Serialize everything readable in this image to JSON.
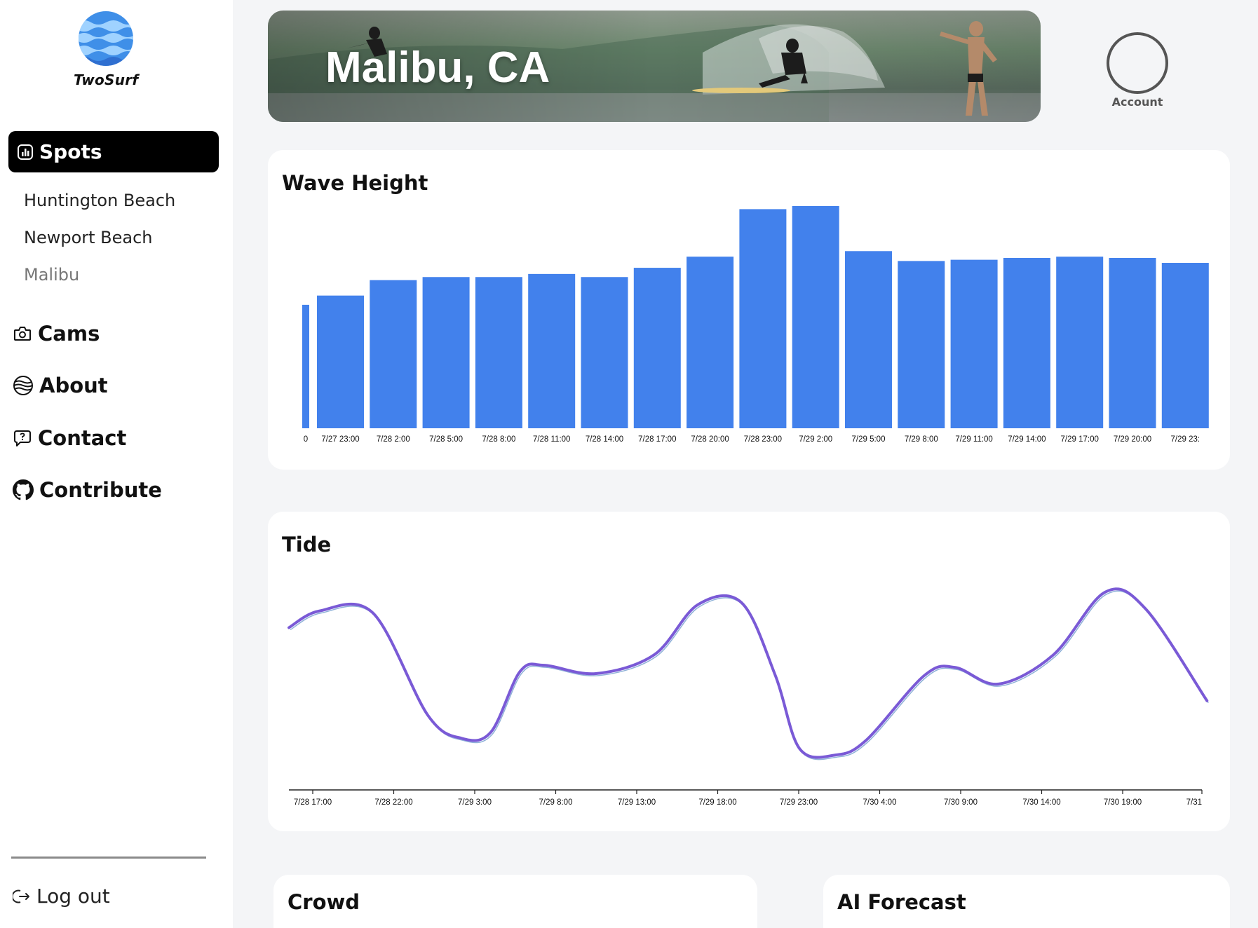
{
  "app": {
    "name": "TwoSurf"
  },
  "sidebar": {
    "active": {
      "label": "Spots",
      "icon": "bar-chart-icon"
    },
    "spots": [
      {
        "label": "Huntington Beach"
      },
      {
        "label": "Newport Beach"
      },
      {
        "label": "Malibu"
      }
    ],
    "nav": [
      {
        "label": "Cams",
        "icon": "camera-icon"
      },
      {
        "label": "About",
        "icon": "globe-icon"
      },
      {
        "label": "Contact",
        "icon": "chat-bubble-icon"
      },
      {
        "label": "Contribute",
        "icon": "github-icon"
      }
    ],
    "logout": {
      "label": "Log out",
      "icon": "logout-icon"
    }
  },
  "header": {
    "title": "Malibu, CA",
    "account_label": "Account"
  },
  "colors": {
    "bar": "#4281ec",
    "tide": "#7a5ad6",
    "active_nav_bg": "#000000"
  },
  "cards": {
    "wave_title": "Wave Height",
    "tide_title": "Tide",
    "crowd_title": "Crowd",
    "ai_title": "AI Forecast"
  },
  "chart_data": [
    {
      "type": "bar",
      "title": "Wave Height",
      "categories": [
        "0",
        "7/27 23:00",
        "7/28 2:00",
        "7/28 5:00",
        "7/28 8:00",
        "7/28 11:00",
        "7/28 14:00",
        "7/28 17:00",
        "7/28 20:00",
        "7/28 23:00",
        "7/29 2:00",
        "7/29 5:00",
        "7/29 8:00",
        "7/29 11:00",
        "7/29 14:00",
        "7/29 17:00",
        "7/29 20:00",
        "7/29 23:"
      ],
      "values": [
        2.0,
        2.15,
        2.4,
        2.45,
        2.45,
        2.5,
        2.45,
        2.6,
        2.78,
        3.55,
        3.6,
        2.87,
        2.71,
        2.73,
        2.76,
        2.78,
        2.76,
        2.68
      ],
      "ylim": [
        0,
        3.6
      ],
      "grid": false
    },
    {
      "type": "line",
      "title": "Tide",
      "x_ticks": [
        "7/28 17:00",
        "7/28 22:00",
        "7/29 3:00",
        "7/29 8:00",
        "7/29 13:00",
        "7/29 18:00",
        "7/29 23:00",
        "7/30 4:00",
        "7/30 9:00",
        "7/30 14:00",
        "7/30 19:00",
        "7/31"
      ],
      "x_hours": [
        -1.4,
        0.5,
        3.8,
        7.2,
        9.3,
        11.1,
        12.9,
        14.4,
        17.6,
        21.2,
        23.9,
        26.6,
        28.7,
        30.2,
        32.4,
        34.3,
        37.9,
        39.8,
        42.5,
        45.9,
        49.1,
        51.6,
        55.4
      ],
      "values": [
        4.1,
        4.5,
        4.45,
        2.0,
        1.45,
        1.6,
        3.05,
        3.2,
        3.0,
        3.45,
        4.65,
        4.7,
        2.95,
        1.2,
        1.05,
        1.4,
        2.95,
        3.15,
        2.75,
        3.45,
        4.95,
        4.55,
        2.35
      ],
      "ylim": [
        0.5,
        5.4
      ],
      "grid": false
    }
  ]
}
